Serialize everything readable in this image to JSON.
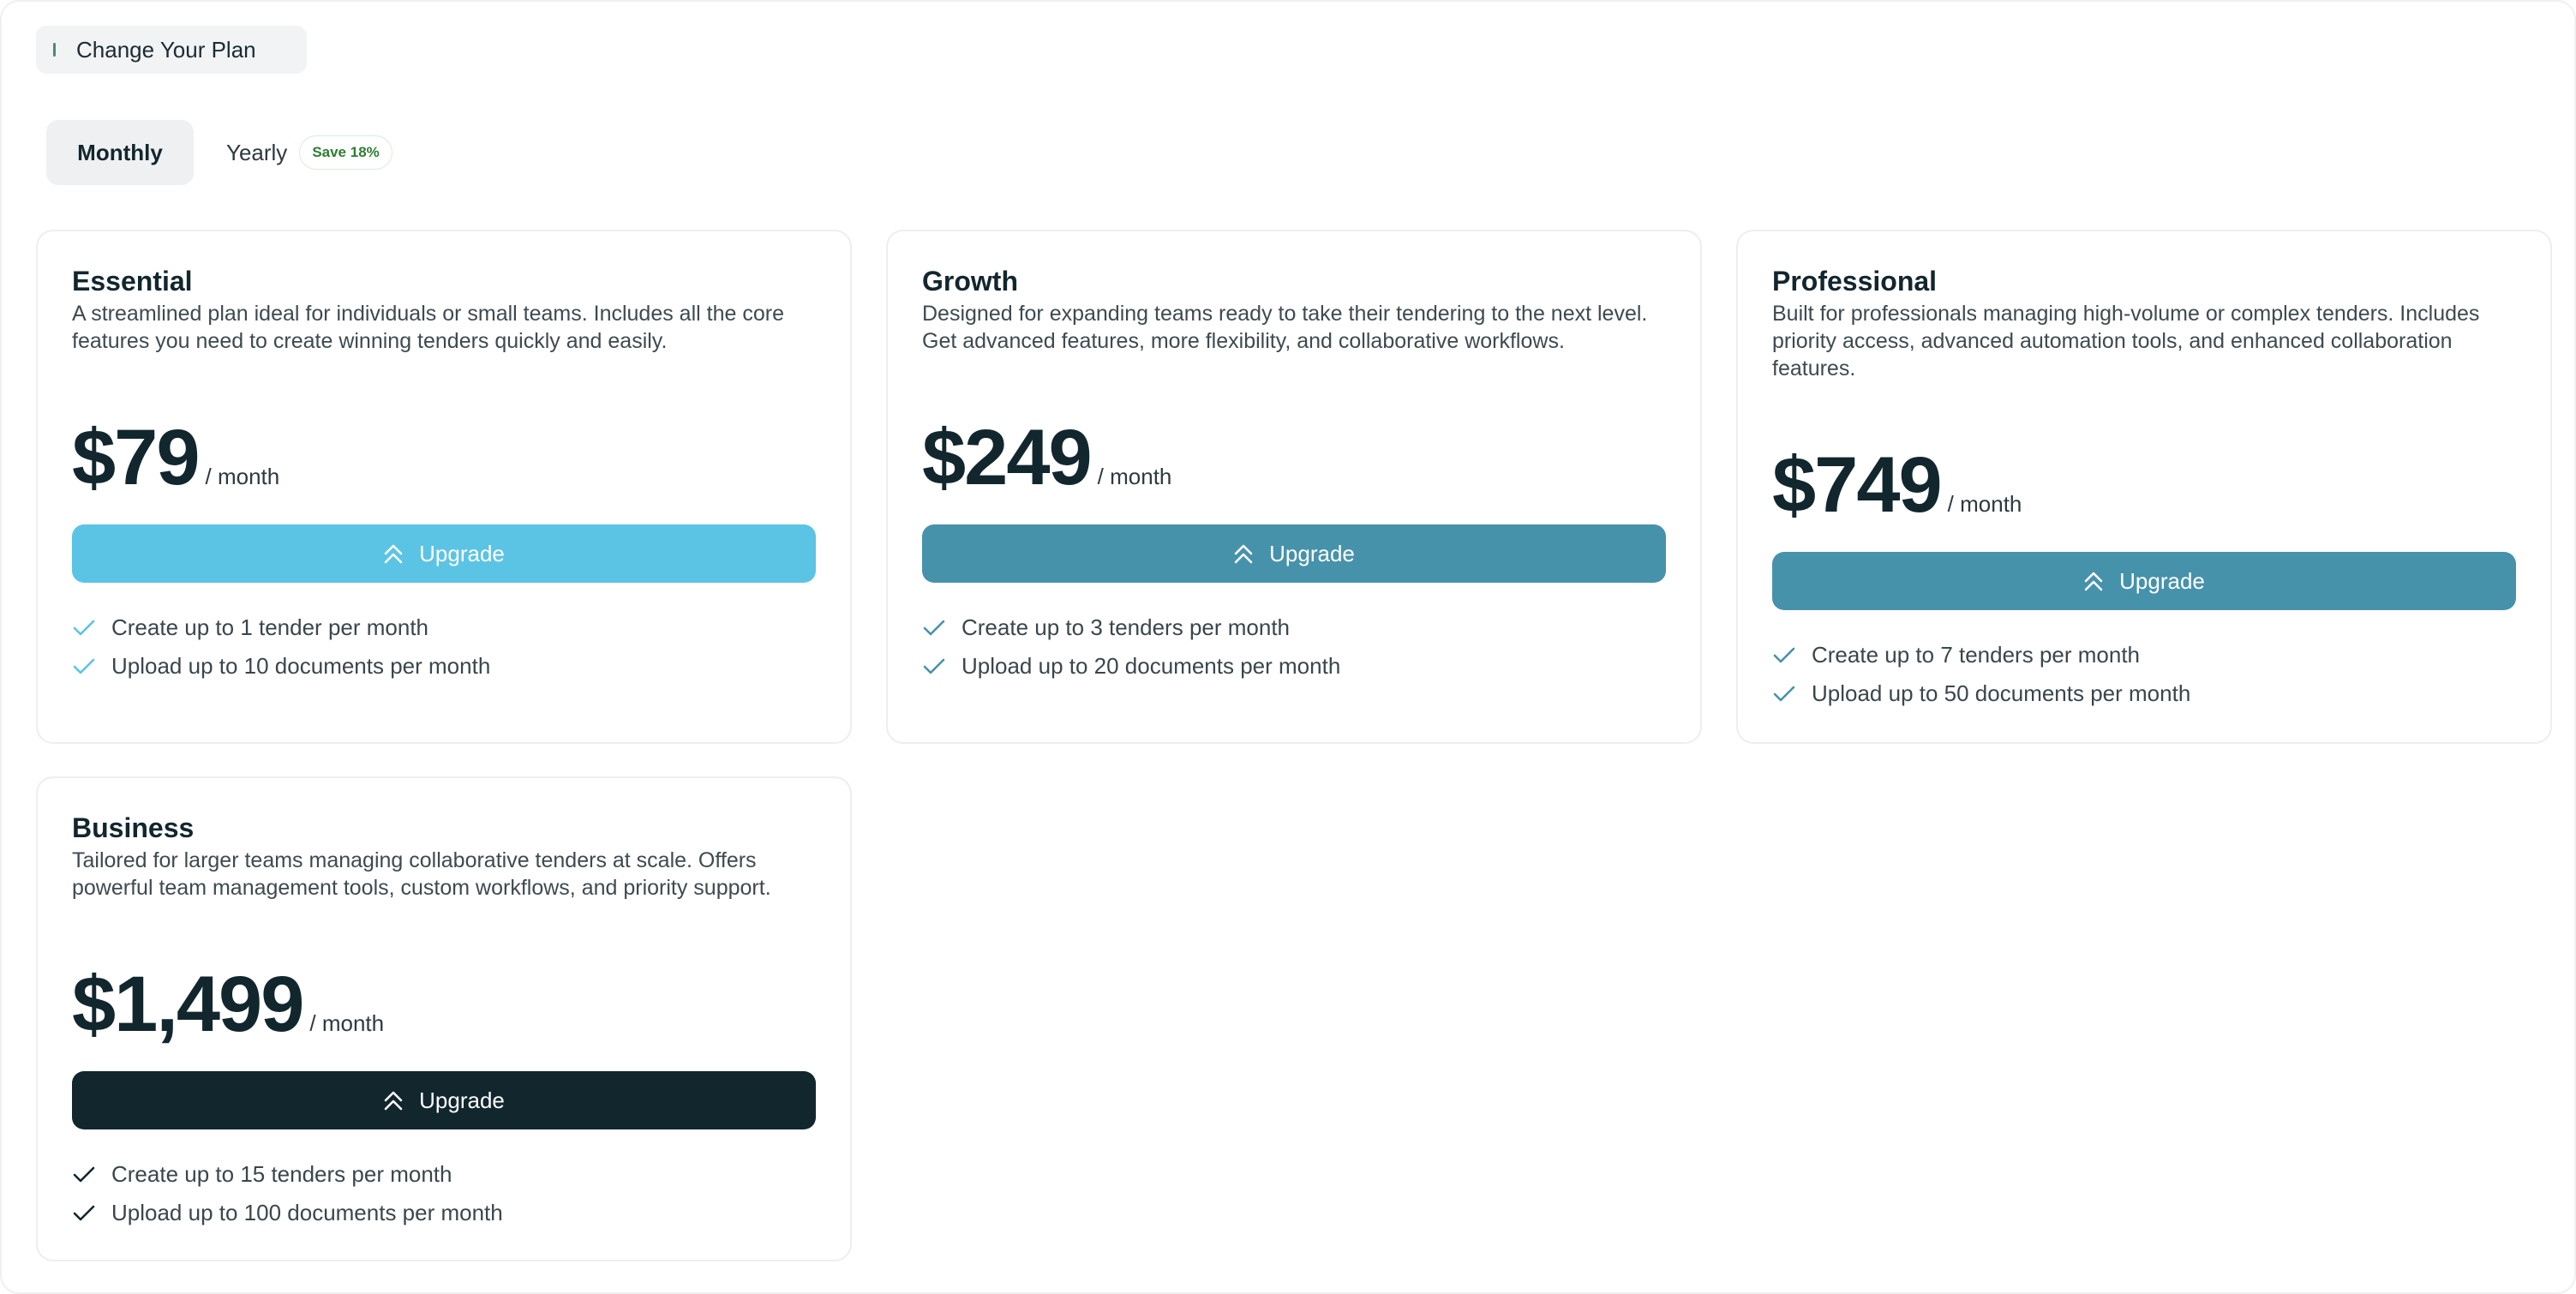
{
  "header": {
    "title": "Change Your Plan"
  },
  "billing": {
    "monthly_label": "Monthly",
    "yearly_label": "Yearly",
    "yearly_badge": "Save 18%"
  },
  "plans": [
    {
      "name": "Essential",
      "description": "A streamlined plan ideal for individuals or small teams. Includes all the core features you need to create winning tenders quickly and easily.",
      "price": "$79",
      "period": "/ month",
      "button_label": "Upgrade",
      "button_color": "#5bc4e4",
      "check_color": "#5bc4e4",
      "features": [
        "Create up to 1 tender per month",
        "Upload up to 10 documents per month"
      ]
    },
    {
      "name": "Growth",
      "description": "Designed for expanding teams ready to take their tendering to the next level. Get advanced features, more flexibility, and collaborative workflows.",
      "price": "$249",
      "period": "/ month",
      "button_label": "Upgrade",
      "button_color": "#4792ab",
      "check_color": "#4792ab",
      "features": [
        "Create up to 3 tenders per month",
        "Upload up to 20 documents per month"
      ]
    },
    {
      "name": "Professional",
      "description": "Built for professionals managing high-volume or complex tenders. Includes priority access, advanced automation tools, and enhanced collaboration features.",
      "price": "$749",
      "period": "/ month",
      "button_label": "Upgrade",
      "button_color": "#4792ab",
      "check_color": "#4792ab",
      "features": [
        "Create up to 7 tenders per month",
        "Upload up to 50 documents per month"
      ]
    },
    {
      "name": "Business",
      "description": "Tailored for larger teams managing collaborative tenders at scale. Offers powerful team management tools, custom workflows, and priority support.",
      "price": "$1,499",
      "period": "/ month",
      "button_label": "Upgrade",
      "button_color": "#12262e",
      "check_color": "#12262e",
      "features": [
        "Create up to 15 tenders per month",
        "Upload up to 100 documents per month"
      ]
    }
  ]
}
